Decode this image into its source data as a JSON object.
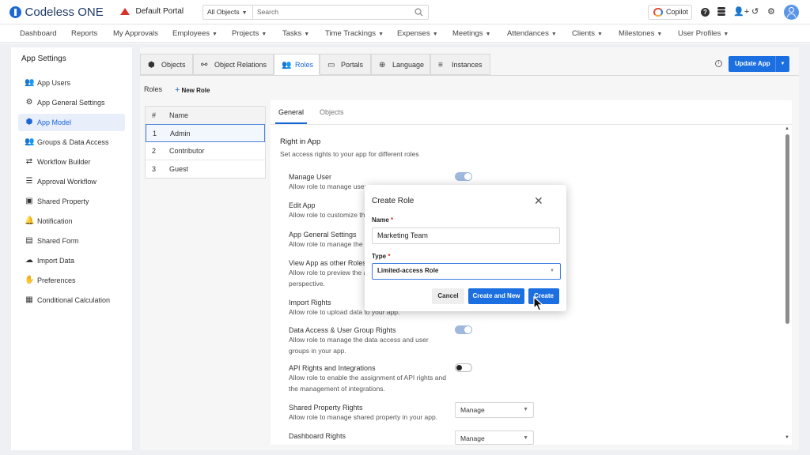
{
  "header": {
    "brand": "Codeless ONE",
    "portal": "Default Portal",
    "search_scope": "All Objects",
    "search_placeholder": "Search",
    "copilot": "Copilot"
  },
  "menu": [
    "Dashboard",
    "Reports",
    "My Approvals",
    "Employees",
    "Projects",
    "Tasks",
    "Time Trackings",
    "Expenses",
    "Meetings",
    "Attendances",
    "Clients",
    "Milestones",
    "User Profiles"
  ],
  "menu_with_caret": [
    false,
    false,
    false,
    true,
    true,
    true,
    true,
    true,
    true,
    true,
    true,
    true,
    true
  ],
  "sidebar": {
    "title": "App Settings",
    "items": [
      "App Users",
      "App General Settings",
      "App Model",
      "Groups & Data Access",
      "Workflow Builder",
      "Approval Workflow",
      "Shared Property",
      "Notification",
      "Shared Form",
      "Import Data",
      "Preferences",
      "Conditional Calculation"
    ]
  },
  "tabs": [
    "Objects",
    "Object Relations",
    "Roles",
    "Portals",
    "Language",
    "Instances"
  ],
  "update_app": "Update App",
  "roles": {
    "label": "Roles",
    "new_role": "New Role",
    "col_num": "#",
    "col_name": "Name",
    "rows": [
      {
        "num": "1",
        "name": "Admin"
      },
      {
        "num": "2",
        "name": "Contributor"
      },
      {
        "num": "3",
        "name": "Guest"
      }
    ]
  },
  "panel": {
    "tab_general": "General",
    "tab_objects": "Objects",
    "section_title": "Right in App",
    "section_desc": "Set access rights to your app for different roles",
    "perms": [
      {
        "title": "Manage User",
        "desc": "Allow role to manage user"
      },
      {
        "title": "Edit App",
        "desc": "Allow role to customize the"
      },
      {
        "title": "App General Settings",
        "desc": "Allow role to manage the g"
      },
      {
        "title": "View App as other Roles",
        "desc": "Allow role to preview the a perspective."
      },
      {
        "title": "Import Rights",
        "desc": "Allow role to upload data to your app."
      },
      {
        "title": "Data Access & User Group Rights",
        "desc": "Allow role to manage the data access and user groups in your app."
      },
      {
        "title": "API Rights and Integrations",
        "desc": "Allow role to enable the assignment of API rights and the management of integrations."
      },
      {
        "title": "Shared Property Rights",
        "desc": "Allow role to manage shared property in your app."
      },
      {
        "title": "Dashboard Rights",
        "desc": ""
      }
    ],
    "shared_property_select": "Manage",
    "dashboard_select": "Manage"
  },
  "dialog": {
    "title": "Create Role",
    "name_label": "Name",
    "name_value": "Marketing Team",
    "type_label": "Type",
    "type_value": "Limited-access Role",
    "required_mark": "*",
    "cancel": "Cancel",
    "create_and_new": "Create and New",
    "create": "Create"
  },
  "colors": {
    "accent": "#1b6fe0",
    "brand_blue": "#1b66d9",
    "portal_red": "#d9342b"
  }
}
